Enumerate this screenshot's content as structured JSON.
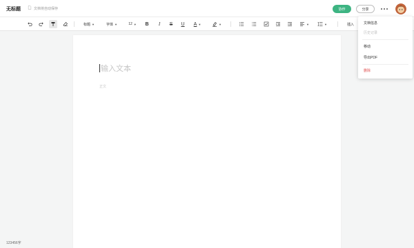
{
  "header": {
    "title": "无标题",
    "save_status": "文档将自动保存",
    "collab_label": "协作",
    "share_label": "分享"
  },
  "toolbar": {
    "heading_label": "标题",
    "font_label": "字体",
    "font_size": "12",
    "insert_label": "插入"
  },
  "editor": {
    "title_placeholder": "输入文本",
    "body_placeholder": "正文"
  },
  "status": {
    "word_count": "123456字"
  },
  "menu": {
    "items": [
      {
        "label": "文档信息"
      },
      {
        "label": "历史记录"
      },
      {
        "label": "移动"
      },
      {
        "label": "导出PDF"
      },
      {
        "label": "删除"
      }
    ]
  },
  "colors": {
    "accent": "#3db482",
    "danger": "#e05353"
  }
}
